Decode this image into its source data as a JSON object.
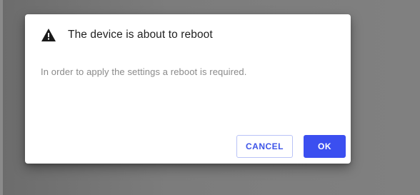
{
  "dialog": {
    "icon": "warning-icon",
    "title": "The device is about to reboot",
    "message": "In order to apply the settings a reboot is required.",
    "buttons": {
      "cancel_label": "CANCEL",
      "ok_label": "OK"
    }
  },
  "colors": {
    "overlay": "#7a7a7a",
    "dialog_background": "#ffffff",
    "title_text": "#212121",
    "message_text": "#8a8a8a",
    "primary": "#3b4ff0",
    "cancel_border": "#b9c3f7",
    "cancel_text": "#3d54e8"
  }
}
